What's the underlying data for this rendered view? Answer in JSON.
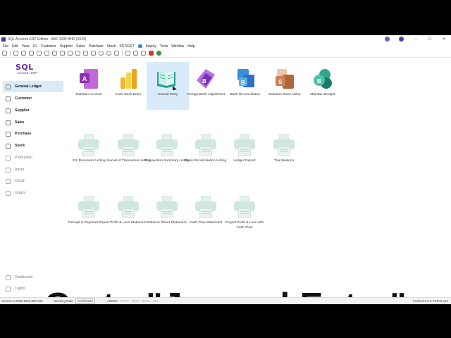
{
  "window": {
    "title": "SQL Account ERP Edition - ABC SDN BHD (2025)",
    "accent": "#6a2fa3"
  },
  "menu": [
    "File",
    "Edit",
    "View",
    "GL",
    "Customer",
    "Supplier",
    "Sales",
    "Purchase",
    "Stock",
    "SST/GST",
    "Inquiry",
    "Tools",
    "Window",
    "Help"
  ],
  "logo": {
    "main": "SQL",
    "sub": "Account / ERP"
  },
  "sidebar": {
    "items": [
      {
        "label": "General Ledger"
      },
      {
        "label": "Customer"
      },
      {
        "label": "Supplier"
      },
      {
        "label": "Sales"
      },
      {
        "label": "Purchase"
      },
      {
        "label": "Stock"
      },
      {
        "label": "Production"
      },
      {
        "label": "Asset"
      },
      {
        "label": "Cloud"
      },
      {
        "label": "Inquiry"
      },
      {
        "label": "Dashboard"
      },
      {
        "label": "Logon"
      }
    ]
  },
  "modules": [
    {
      "label": "Maintain Account",
      "icon": "maintain-account-icon"
    },
    {
      "label": "Cash Book Entry",
      "icon": "cash-book-icon"
    },
    {
      "label": "Journal Entry",
      "icon": "journal-book-icon"
    },
    {
      "label": "Foreign Bank Adjustment",
      "icon": "foreign-bank-icon"
    },
    {
      "label": "Bank Reconciliation",
      "icon": "bank-reconciliation-icon"
    },
    {
      "label": "Maintain Stock Value",
      "icon": "stock-value-icon"
    },
    {
      "label": "Maintain Budget",
      "icon": "budget-icon"
    }
  ],
  "reports_row1": [
    {
      "label": "G/L Document Listing"
    },
    {
      "label": "Journal of Transaction Listing"
    },
    {
      "label": "Transaction Summary Listing"
    },
    {
      "label": "Bank Reconciliation Listing"
    },
    {
      "label": "Ledger Report"
    },
    {
      "label": "Trial Balance"
    }
  ],
  "reports_row2": [
    {
      "label": "Receipt & Payment Report"
    },
    {
      "label": "Profit & Loss Statement"
    },
    {
      "label": "Balance Sheet Statement"
    },
    {
      "label": "Cash Flow Statement"
    },
    {
      "label": "Project Profit & Loss with Cash Flow"
    }
  ],
  "status": {
    "version": "Version 5.2025.1043.880 x86",
    "working_date_label": "Working Date",
    "working_date": "11/09/2025",
    "user": "ADMIN",
    "caps": "CAPS",
    "num": "NUM",
    "scrl": "SCRL",
    "ins": "INS",
    "db": "Firebird 5.0.3 TCPv6 x64"
  },
  "caption": "Go to \"Journal Entry\""
}
